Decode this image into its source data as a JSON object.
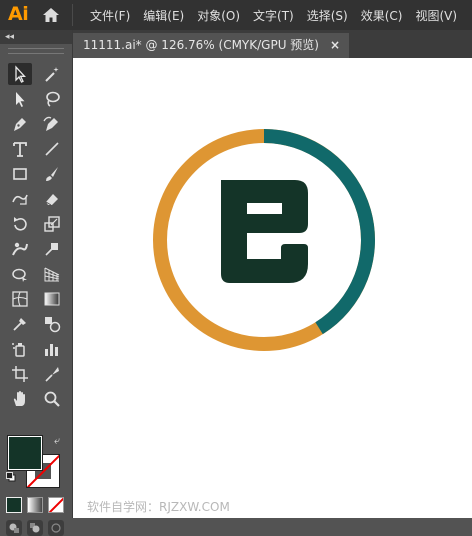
{
  "app": {
    "logo_text": "Ai",
    "logo_color": "#FF9A00"
  },
  "menu": {
    "items": [
      "文件(F)",
      "编辑(E)",
      "对象(O)",
      "文字(T)",
      "选择(S)",
      "效果(C)",
      "视图(V)"
    ]
  },
  "toolbar": {
    "collapse_label": "◂◂",
    "tools": [
      "selection-tool",
      "magic-wand-tool",
      "direct-selection-tool",
      "lasso-tool",
      "pen-tool",
      "curvature-tool",
      "type-tool",
      "line-segment-tool",
      "rectangle-tool",
      "paintbrush-tool",
      "shaper-tool",
      "eraser-tool",
      "rotate-tool",
      "scale-tool",
      "warp-tool",
      "free-transform-tool",
      "shape-builder-tool",
      "perspective-grid-tool",
      "mesh-tool",
      "gradient-tool",
      "eyedropper-tool",
      "blend-tool",
      "symbol-sprayer-tool",
      "column-graph-tool",
      "artboard-tool",
      "slice-tool",
      "hand-tool",
      "zoom-tool"
    ],
    "active_tool": "selection-tool",
    "fill_color": "#143428",
    "stroke": "none"
  },
  "document": {
    "tab_title": "11111.ai* @ 126.76% (CMYK/GPU 预览)",
    "close_glyph": "×"
  },
  "artwork": {
    "ring_colors": {
      "teal": "#11696A",
      "orange": "#DE9633"
    },
    "letter_color": "#143428",
    "letter_shape": "e-logo"
  },
  "watermark": "软件自学网：RJZXW.COM"
}
